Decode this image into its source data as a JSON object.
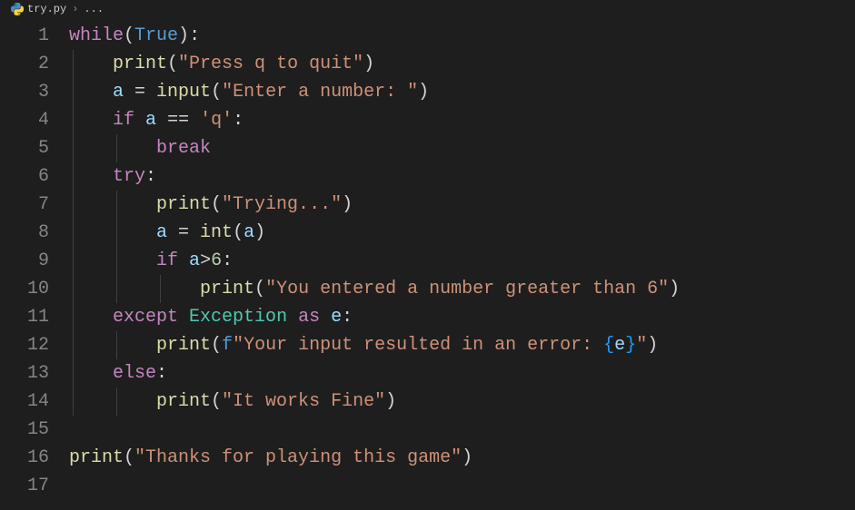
{
  "breadcrumb": {
    "file": "try.py",
    "separator": "›",
    "ellipsis": "..."
  },
  "lines": {
    "count": 17
  },
  "tok": {
    "while": "while",
    "lparen": "(",
    "rparen": ")",
    "colon": ":",
    "True": "True",
    "print": "print",
    "str_press_q": "\"Press q to quit\"",
    "a": "a",
    "eq": " = ",
    "input": "input",
    "str_enter_num": "\"Enter a number: \"",
    "if": "if",
    "deq": " == ",
    "str_q": "'q'",
    "break": "break",
    "try": "try",
    "str_trying": "\"Trying...\"",
    "int": "int",
    "gt": ">",
    "six": "6",
    "str_gt6": "\"You entered a number greater than 6\"",
    "except": "except",
    "Exception": "Exception",
    "as": "as",
    "e": "e",
    "fprefix": "f",
    "str_err1": "\"Your input resulted in an error: ",
    "lbrace": "{",
    "rbrace": "}",
    "str_err2": "\"",
    "else": "else",
    "str_fine": "\"It works Fine\"",
    "str_thanks": "\"Thanks for playing this game\""
  }
}
